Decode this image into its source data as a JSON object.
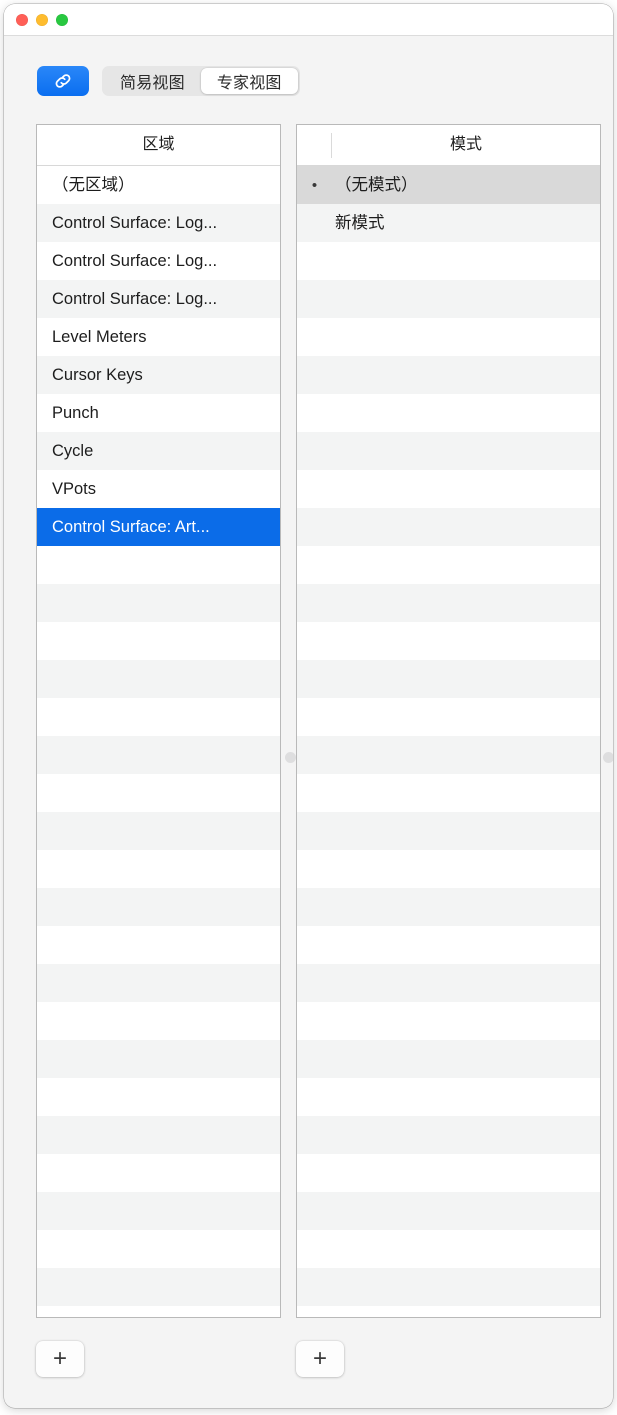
{
  "window": {
    "traffic_lights": [
      {
        "name": "close",
        "color": "#ff5f57"
      },
      {
        "name": "minimize",
        "color": "#febc2e"
      },
      {
        "name": "zoom",
        "color": "#28c840"
      }
    ]
  },
  "toolbar": {
    "link_button": {
      "icon": "link-chain-icon",
      "color": "#1a7cf5"
    },
    "segmented_control": {
      "options": [
        {
          "label": "简易视图",
          "selected": false
        },
        {
          "label": "专家视图",
          "selected": true
        }
      ]
    }
  },
  "zone_list": {
    "header": "区域",
    "rows": [
      {
        "label": "（无区域）",
        "selected": false,
        "stripe": "odd"
      },
      {
        "label": "Control Surface: Log...",
        "selected": false,
        "stripe": "even"
      },
      {
        "label": "Control Surface: Log...",
        "selected": false,
        "stripe": "odd"
      },
      {
        "label": "Control Surface: Log...",
        "selected": false,
        "stripe": "even"
      },
      {
        "label": "Level Meters",
        "selected": false,
        "stripe": "odd"
      },
      {
        "label": "Cursor Keys",
        "selected": false,
        "stripe": "even"
      },
      {
        "label": "Punch",
        "selected": false,
        "stripe": "odd"
      },
      {
        "label": "Cycle",
        "selected": false,
        "stripe": "even"
      },
      {
        "label": "VPots",
        "selected": false,
        "stripe": "odd"
      },
      {
        "label": "Control Surface: Art...",
        "selected": true,
        "stripe": "even"
      }
    ],
    "empty_row_count": 20,
    "add_button_label": "+"
  },
  "mode_list": {
    "header": "模式",
    "rows": [
      {
        "bullet": "•",
        "label": "（无模式）",
        "selected": true,
        "stripe": "odd"
      },
      {
        "bullet": "",
        "label": "新模式",
        "selected": false,
        "stripe": "even"
      }
    ],
    "empty_row_count": 28,
    "add_button_label": "+"
  },
  "colors": {
    "accent_blue": "#0b6ce8",
    "selection_inactive": "#d9d9d9",
    "stripe": "#f3f4f4",
    "window_background": "#f4f4f4"
  }
}
